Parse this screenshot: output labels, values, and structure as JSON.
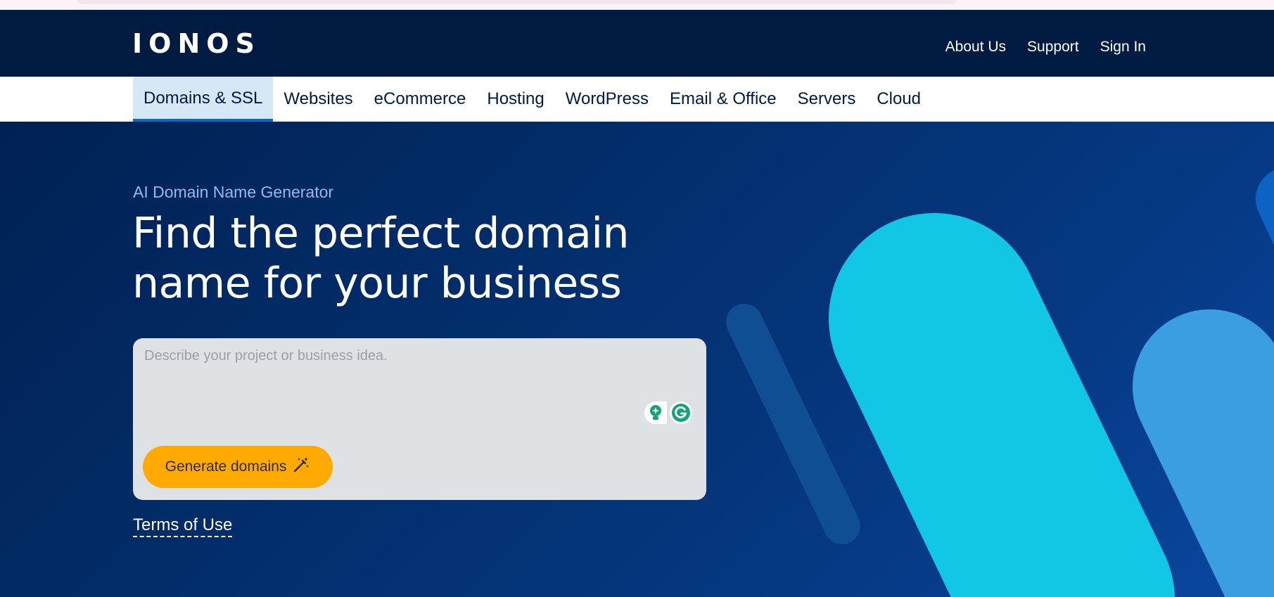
{
  "brand": {
    "logo_text": "IONOS"
  },
  "header": {
    "links": [
      "About Us",
      "Support",
      "Sign In"
    ]
  },
  "subnav": {
    "items": [
      "Domains & SSL",
      "Websites",
      "eCommerce",
      "Hosting",
      "WordPress",
      "Email & Office",
      "Servers",
      "Cloud"
    ],
    "active": "Domains & SSL"
  },
  "hero": {
    "eyebrow": "AI Domain Name Generator",
    "headline": "Find the perfect domain name for your business",
    "input_placeholder": "Describe your project or business idea.",
    "generate_label": "Generate domains",
    "terms_label": "Terms of Use"
  },
  "colors": {
    "header_bg": "#001b41",
    "hero_bg": "#03306f",
    "accent_button": "#ffaa00",
    "shape_cyan": "#12c6e6",
    "shape_light_blue": "#3b9ee0",
    "active_tab_bg": "#d7e7f6",
    "active_tab_border": "#0b6bc4"
  },
  "icons": {
    "generate": "magic-wand-icon",
    "grammarly_suggest": "lightbulb-icon",
    "grammarly": "grammarly-g-icon"
  }
}
